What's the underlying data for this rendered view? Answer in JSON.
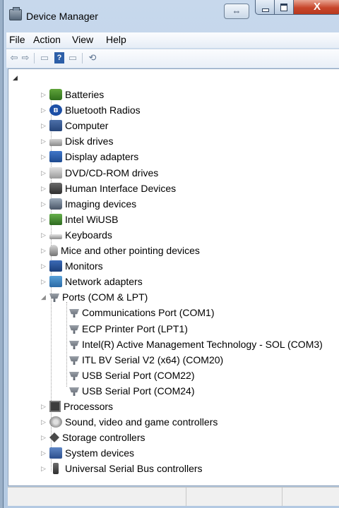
{
  "window": {
    "title": "Device Manager"
  },
  "caption": {
    "snap_glyph": "⇔",
    "close_glyph": "X"
  },
  "menu": {
    "file": "File",
    "action": "Action",
    "view": "View",
    "help": "Help"
  },
  "toolbar": {
    "back": "⇦",
    "forward": "⇨",
    "properties": "▭",
    "help": "?",
    "update": "▭",
    "scan": "⟲"
  },
  "tree": {
    "root_expander": "◢",
    "categories": [
      {
        "label": "Batteries",
        "icon": "battery-icon"
      },
      {
        "label": "Bluetooth Radios",
        "icon": "bluetooth-icon"
      },
      {
        "label": "Computer",
        "icon": "computer-icon"
      },
      {
        "label": "Disk drives",
        "icon": "disk-drive-icon"
      },
      {
        "label": "Display adapters",
        "icon": "display-adapter-icon"
      },
      {
        "label": "DVD/CD-ROM drives",
        "icon": "dvd-drive-icon"
      },
      {
        "label": "Human Interface Devices",
        "icon": "hid-icon"
      },
      {
        "label": "Imaging devices",
        "icon": "camera-icon"
      },
      {
        "label": "Intel WiUSB",
        "icon": "network-icon"
      },
      {
        "label": "Keyboards",
        "icon": "keyboard-icon"
      },
      {
        "label": "Mice and other pointing devices",
        "icon": "mouse-icon"
      },
      {
        "label": "Monitors",
        "icon": "monitor-icon"
      },
      {
        "label": "Network adapters",
        "icon": "network-adapter-icon"
      },
      {
        "label": "Ports (COM & LPT)",
        "icon": "port-icon"
      }
    ],
    "ports_children": [
      {
        "label": "Communications Port (COM1)"
      },
      {
        "label": "ECP Printer Port (LPT1)"
      },
      {
        "label": "Intel(R) Active Management Technology - SOL (COM3)"
      },
      {
        "label": "ITL BV Serial V2 (x64) (COM20)"
      },
      {
        "label": "USB Serial Port (COM22)"
      },
      {
        "label": "USB Serial Port (COM24)"
      }
    ],
    "categories_after": [
      {
        "label": "Processors",
        "icon": "processor-icon"
      },
      {
        "label": "Sound, video and game controllers",
        "icon": "sound-icon"
      },
      {
        "label": "Storage controllers",
        "icon": "storage-icon"
      },
      {
        "label": "System devices",
        "icon": "system-icon"
      },
      {
        "label": "Universal Serial Bus controllers",
        "icon": "usb-icon"
      }
    ],
    "collapsed_glyph": "▷",
    "expanded_glyph": "◢"
  }
}
